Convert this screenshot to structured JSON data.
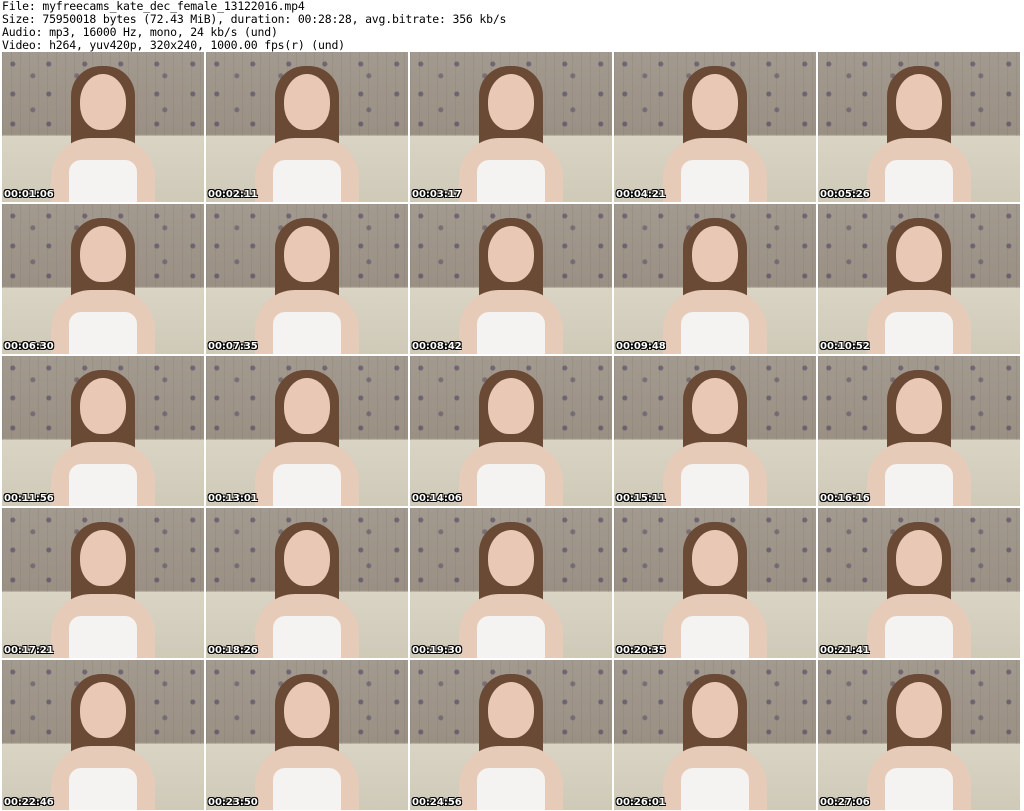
{
  "header": {
    "line1": "File: myfreecams_kate_dec_female_13122016.mp4",
    "line2": "Size: 75950018 bytes (72.43 MiB), duration: 00:28:28, avg.bitrate: 356 kb/s",
    "line3": "Audio: mp3, 16000 Hz, mono, 24 kb/s (und)",
    "line4": "Video: h264, yuv420p, 320x240, 1000.00 fps(r) (und)"
  },
  "thumbnails": [
    {
      "timestamp": "00:01:06"
    },
    {
      "timestamp": "00:02:11"
    },
    {
      "timestamp": "00:03:17"
    },
    {
      "timestamp": "00:04:21"
    },
    {
      "timestamp": "00:05:26"
    },
    {
      "timestamp": "00:06:30"
    },
    {
      "timestamp": "00:07:35"
    },
    {
      "timestamp": "00:08:42"
    },
    {
      "timestamp": "00:09:48"
    },
    {
      "timestamp": "00:10:52"
    },
    {
      "timestamp": "00:11:56"
    },
    {
      "timestamp": "00:13:01"
    },
    {
      "timestamp": "00:14:06"
    },
    {
      "timestamp": "00:15:11"
    },
    {
      "timestamp": "00:16:16"
    },
    {
      "timestamp": "00:17:21"
    },
    {
      "timestamp": "00:18:26"
    },
    {
      "timestamp": "00:19:30"
    },
    {
      "timestamp": "00:20:35"
    },
    {
      "timestamp": "00:21:41"
    },
    {
      "timestamp": "00:22:46"
    },
    {
      "timestamp": "00:23:50"
    },
    {
      "timestamp": "00:24:56"
    },
    {
      "timestamp": "00:26:01"
    },
    {
      "timestamp": "00:27:06"
    }
  ]
}
